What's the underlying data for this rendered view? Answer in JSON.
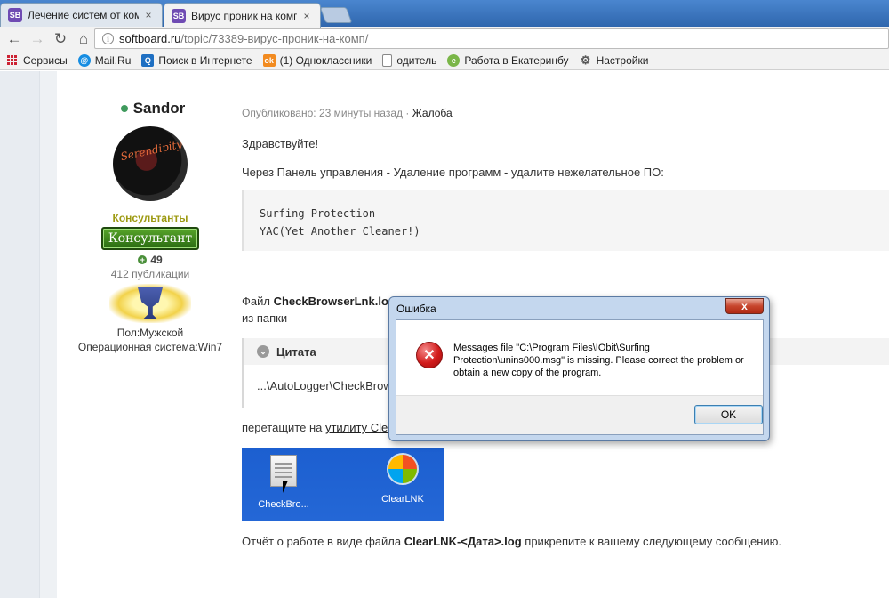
{
  "browser": {
    "tabs": [
      {
        "title": "Лечение систем от комп",
        "favicon": "SB",
        "active": false
      },
      {
        "title": "Вирус проник на комп -",
        "favicon": "SB",
        "active": true
      }
    ],
    "close_glyph": "×",
    "url_host": "softboard.ru",
    "url_path": "/topic/73389-вирус-проник-на-комп/",
    "bookmarks": [
      {
        "label": "Сервисы",
        "icon": "apps-grid-icon"
      },
      {
        "label": "Mail.Ru",
        "icon": "mailru-icon",
        "color": "#168de2"
      },
      {
        "label": "Поиск в Интернете",
        "icon": "search-icon",
        "color": "#1e6fc2"
      },
      {
        "label": "(1) Одноклассники",
        "icon": "odnoklassniki-icon",
        "color": "#f28b20"
      },
      {
        "label": "одитель",
        "icon": "page-icon"
      },
      {
        "label": "Работа в Екатеринбу",
        "icon": "job-icon",
        "color": "#7ab648"
      },
      {
        "label": "Настройки",
        "icon": "gear-icon"
      }
    ]
  },
  "author": {
    "name": "Sandor",
    "avatar_text": "Serendipity",
    "group": "Консультанты",
    "rank": "Консультант",
    "reputation": "49",
    "posts": "412 публикации",
    "gender": "Пол:Мужской",
    "os": "Операционная система:Win7"
  },
  "post": {
    "published": "Опубликовано: 23 минуты назад",
    "separator": "·",
    "report": "Жалоба",
    "greeting": "Здравствуйте!",
    "instruction": "Через Панель управления - Удаление программ - удалите нежелательное ПО:",
    "code_lines": [
      "Surfing Protection",
      "YAC(Yet Another Cleaner!)"
    ],
    "file_prefix": "Файл ",
    "file_name": "CheckBrowserLnk.lo",
    "from_folder": "из папки",
    "quote_title": "Цитата",
    "quote_text": "...\\AutoLogger\\CheckBrow",
    "drag_prefix": "перетащите на ",
    "drag_link": "утилиту Cle",
    "desktop_icons": [
      {
        "label": "CheckBro..."
      },
      {
        "label": "ClearLNK"
      }
    ],
    "report_prefix": "Отчёт о работе в виде файла ",
    "report_file": "ClearLNK-<Дата>.log",
    "report_suffix": " прикрепите к вашему следующему сообщению."
  },
  "dialog": {
    "title": "Ошибка",
    "close": "x",
    "message": "Messages file \"C:\\Program Files\\IObit\\Surfing Protection\\unins000.msg\" is missing. Please correct the problem or obtain a new copy of the program.",
    "ok_label": "OK",
    "error_glyph": "✕"
  },
  "colors": {
    "online": "#3f9a5d",
    "group": "#9d9a12",
    "rank_badge": "#3b8a1c",
    "error": "#d21b1b"
  }
}
